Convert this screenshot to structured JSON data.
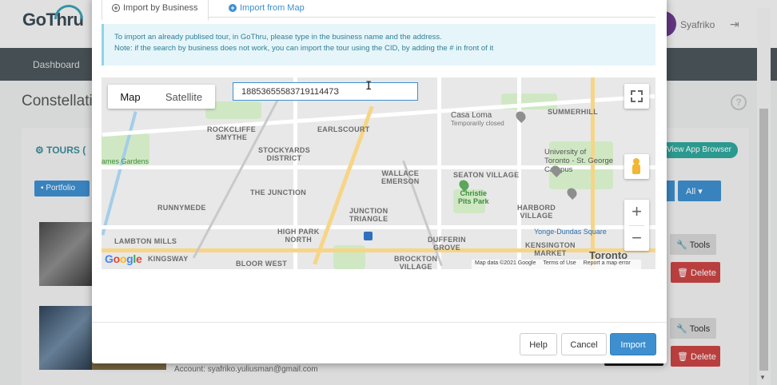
{
  "app": {
    "logo_text": "GoThru",
    "user_name": "Syafriko",
    "nav_dashboard": "Dashboard",
    "page_title": "Constellatio",
    "help_symbol": "?",
    "logout_icon": "logout-icon"
  },
  "background": {
    "tours_heading": "TOURS (",
    "view_app_browser": "View App Browser",
    "portfolio_label": "Portfolio",
    "filter_all": "All",
    "tools_label": "Tools",
    "delete_label": "Delete",
    "account_line": "Account: syafriko.yuliusman@gmail.com"
  },
  "modal": {
    "tabs": [
      {
        "label": "Import by Business",
        "icon": "plus-circle-icon",
        "active": true
      },
      {
        "label": "Import from Map",
        "icon": "plus-circle-icon",
        "active": false
      }
    ],
    "info_line1": "To import an already publised tour, in GoThru, please type in the business name and the address.",
    "info_line2": "Note: if the search by business does not work, you can import the tour using the CID, by adding the # in front of it",
    "search": {
      "value": "1885365558371911447З",
      "placeholder": ""
    },
    "map": {
      "type_map": "Map",
      "type_satellite": "Satellite",
      "google_logo": "Google",
      "attribution": [
        "Map data ©2021 Google",
        "Terms of Use",
        "Report a map error"
      ],
      "zoom_in": "+",
      "zoom_out": "−",
      "labels": {
        "rockcliffe": "ROCKCLIFFE\nSMYTHE",
        "earlscourt": "EARLSCOURT",
        "stockyards": "STOCKYARDS\nDISTRICT",
        "casa_loma": "Casa Loma",
        "temp_closed": "Temporarily closed",
        "summerhill": "SUMMERHILL",
        "james_gardens": "ames Gardens",
        "wallace": "WALLACE\nEMERSON",
        "seaton": "SEATON VILLAGE",
        "university": "University of\nToronto - St. George\nCampus",
        "the_junction": "THE JUNCTION",
        "christie": "Christie\nPits Park",
        "runnymede": "RUNNYMEDE",
        "junction_triangle": "JUNCTION\nTRIANGLE",
        "harbord": "HARBORD\nVILLAGE",
        "yonge_dundas": "Yonge-Dundas Square",
        "high_park_north": "HIGH PARK\nNORTH",
        "lambton_mills": "LAMBTON MILLS",
        "dufferin_grove": "DUFFERIN\nGROVE",
        "kensington": "KENSINGTON\nMARKET",
        "kingsway": "KINGSWAY",
        "bloor_west": "BLOOR WEST",
        "brockton": "BROCKTON\nVILLAGE",
        "toronto": "Toronto"
      }
    },
    "footer": {
      "help": "Help",
      "cancel": "Cancel",
      "import": "Import"
    }
  },
  "colors": {
    "primary": "#3d8fcf",
    "info_bg": "#e6f5fa",
    "info_text": "#2e7f96",
    "nav_bg": "#4b5559",
    "danger": "#c94545",
    "teal": "#2fa79c"
  }
}
